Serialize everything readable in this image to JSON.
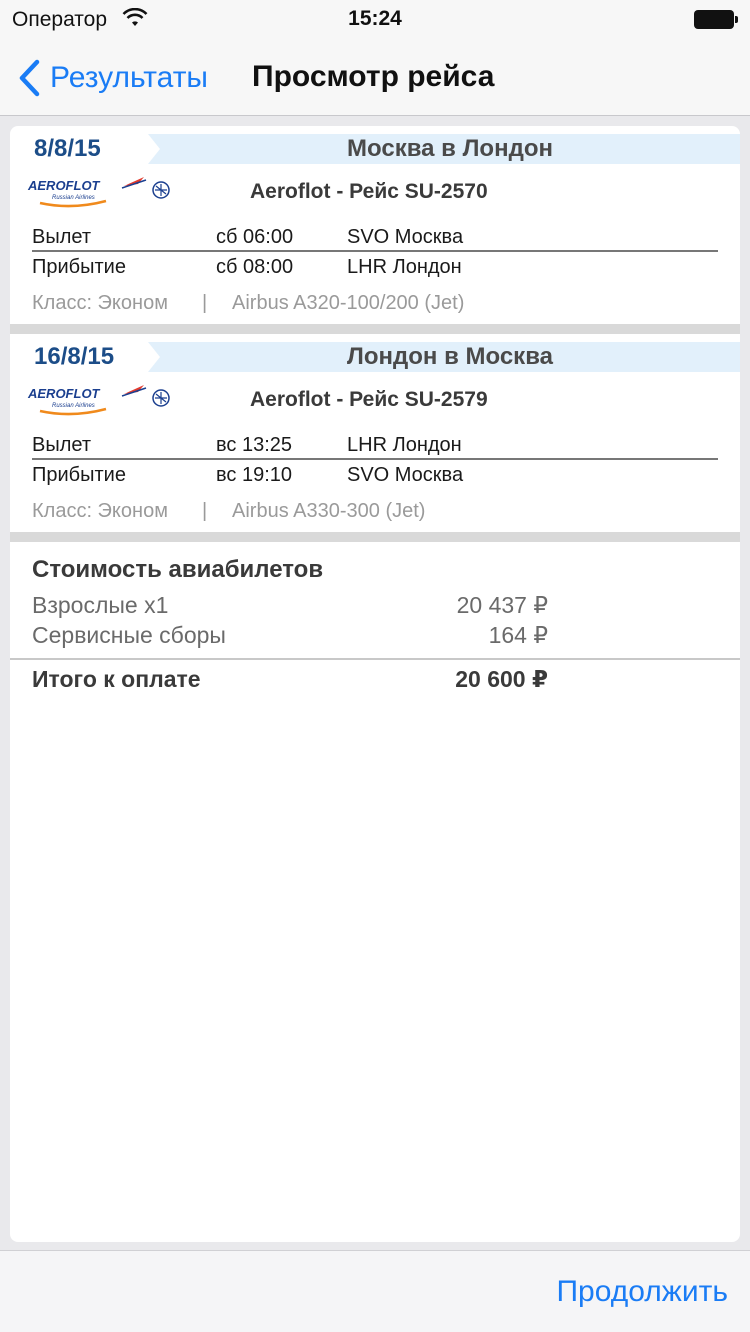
{
  "status_bar": {
    "carrier": "Оператор",
    "time": "15:24"
  },
  "nav": {
    "back_label": "Результаты",
    "title": "Просмотр рейса"
  },
  "segments": [
    {
      "date": "8/8/15",
      "route": "Москва в Лондон",
      "flight": "Aeroflot - Рейс SU-2570",
      "departure": {
        "label": "Вылет",
        "time": "сб 06:00",
        "airport": "SVO Москва"
      },
      "arrival": {
        "label": "Прибытие",
        "time": "сб 08:00",
        "airport": "LHR Лондон"
      },
      "class": "Класс: Эконом",
      "separator": "|",
      "aircraft": "Airbus A320-100/200 (Jet)"
    },
    {
      "date": "16/8/15",
      "route": "Лондон в Москва",
      "flight": "Aeroflot - Рейс SU-2579",
      "departure": {
        "label": "Вылет",
        "time": "вс 13:25",
        "airport": "LHR Лондон"
      },
      "arrival": {
        "label": "Прибытие",
        "time": "вс 19:10",
        "airport": "SVO Москва"
      },
      "class": "Класс: Эконом",
      "separator": "|",
      "aircraft": "Airbus A330-300 (Jet)"
    }
  ],
  "airline_logo": {
    "name": "aeroflot-logo",
    "text": "AEROFLOT",
    "subtext": "Russian Airlines"
  },
  "pricing": {
    "title": "Стоимость авиабилетов",
    "rows": [
      {
        "label": "Взрослые x1",
        "value": "20 437 ₽"
      },
      {
        "label": "Сервисные сборы",
        "value": "164 ₽"
      }
    ],
    "total": {
      "label": "Итого к оплате",
      "value": "20 600 ₽"
    }
  },
  "toolbar": {
    "continue_label": "Продолжить"
  },
  "colors": {
    "accent": "#1a7cf5",
    "date_text": "#1c4d88",
    "header_band": "#e2f0fb"
  }
}
